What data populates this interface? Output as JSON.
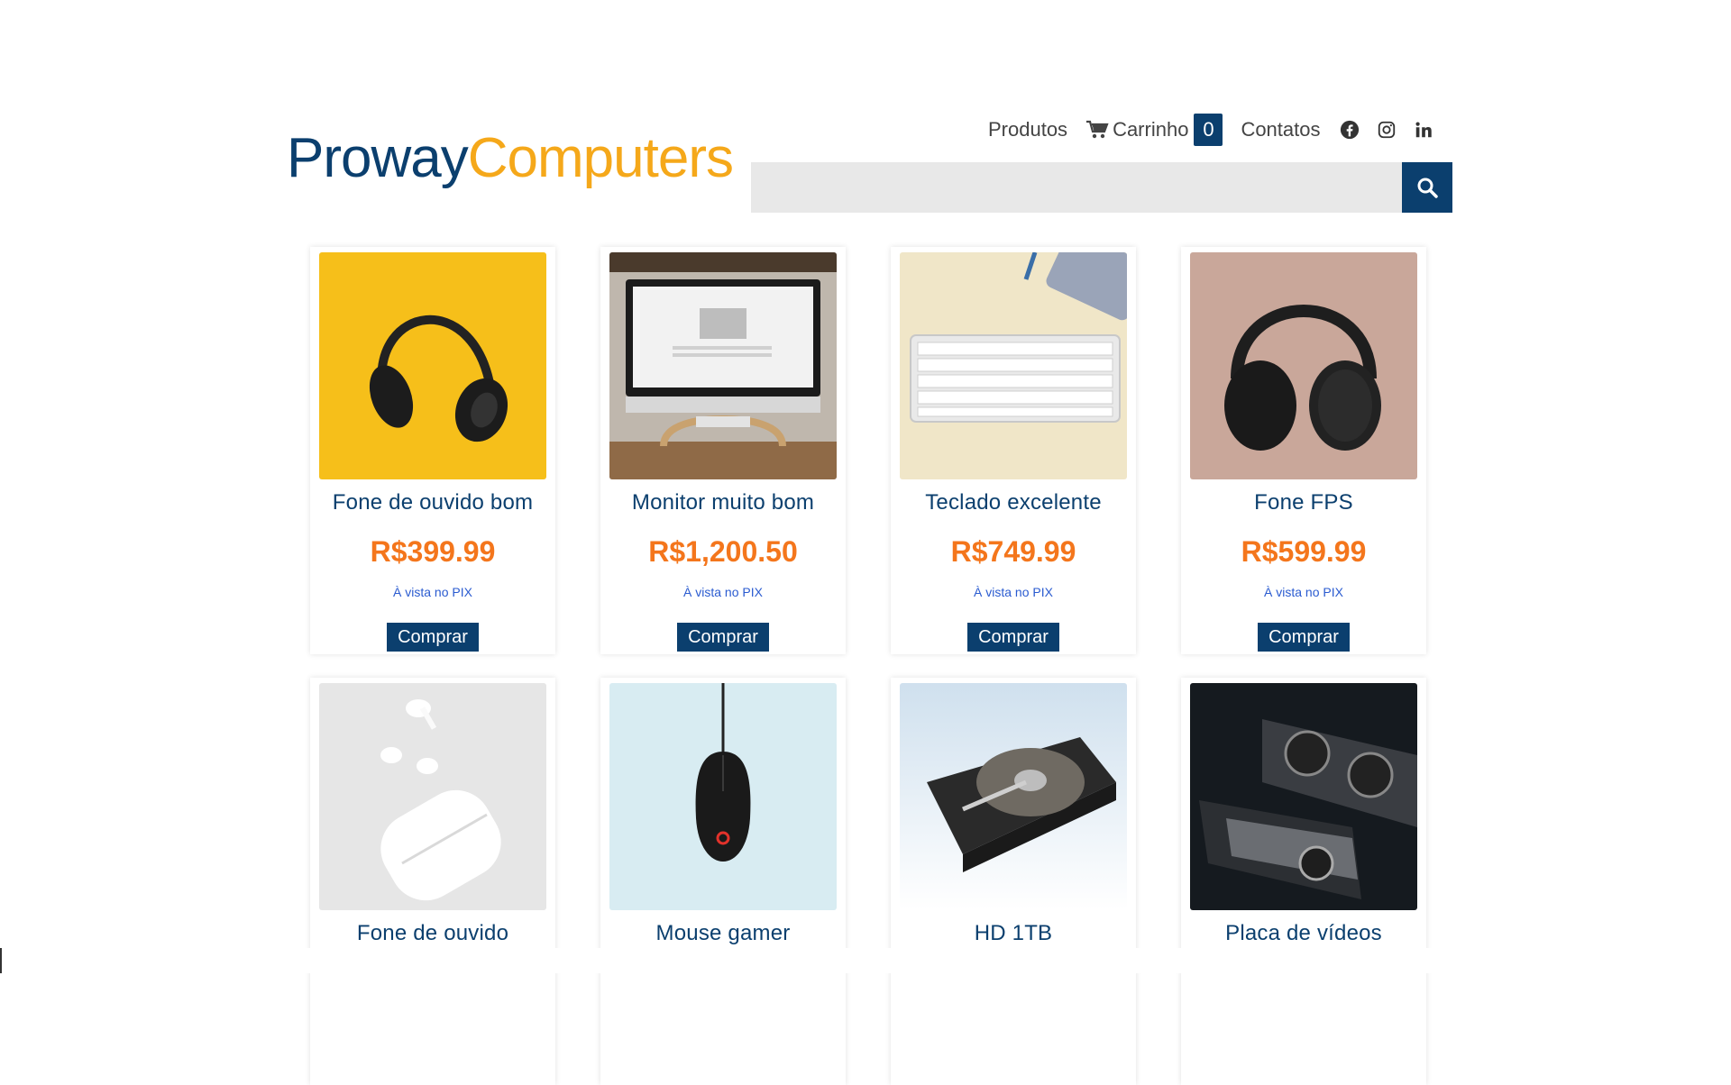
{
  "brand": {
    "part1": "Proway",
    "part2": "Computers"
  },
  "nav": {
    "produtos": "Produtos",
    "carrinho": "Carrinho",
    "cart_count": "0",
    "contatos": "Contatos",
    "social": [
      "facebook-icon",
      "instagram-icon",
      "linkedin-icon"
    ]
  },
  "search": {
    "value": "",
    "placeholder": ""
  },
  "colors": {
    "brand_blue": "#0b3f6e",
    "brand_orange": "#f5a81a",
    "price": "#f4761c",
    "note": "#2a5bd0"
  },
  "products": [
    {
      "name": "Fone de ouvido bom",
      "price": "R$399.99",
      "note": "À vista no PIX",
      "button": "Comprar",
      "image": "headphones-yellow"
    },
    {
      "name": "Monitor muito bom",
      "price": "R$1,200.50",
      "note": "À vista no PIX",
      "button": "Comprar",
      "image": "imac-monitor"
    },
    {
      "name": "Teclado excelente",
      "price": "R$749.99",
      "note": "À vista no PIX",
      "button": "Comprar",
      "image": "white-keyboard"
    },
    {
      "name": "Fone FPS",
      "price": "R$599.99",
      "note": "À vista no PIX",
      "button": "Comprar",
      "image": "black-headphones"
    },
    {
      "name": "Fone de ouvido",
      "price": "",
      "note": "",
      "button": "",
      "image": "airpods"
    },
    {
      "name": "Mouse gamer",
      "price": "",
      "note": "",
      "button": "",
      "image": "gaming-mouse"
    },
    {
      "name": "HD 1TB",
      "price": "",
      "note": "",
      "button": "",
      "image": "hard-drive"
    },
    {
      "name": "Placa de vídeos",
      "price": "",
      "note": "",
      "button": "",
      "image": "graphics-card"
    }
  ]
}
